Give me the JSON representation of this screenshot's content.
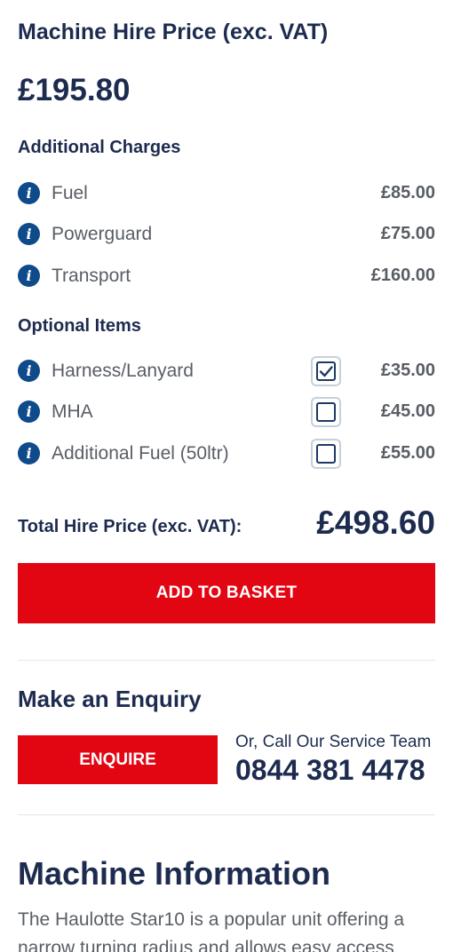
{
  "machine_hire": {
    "title": "Machine Hire Price (exc. VAT)",
    "price": "£195.80"
  },
  "additional_charges": {
    "heading": "Additional Charges",
    "items": [
      {
        "label": "Fuel",
        "price": "£85.00"
      },
      {
        "label": "Powerguard",
        "price": "£75.00"
      },
      {
        "label": "Transport",
        "price": "£160.00"
      }
    ]
  },
  "optional_items": {
    "heading": "Optional Items",
    "items": [
      {
        "label": "Harness/Lanyard",
        "price": "£35.00",
        "checked": true
      },
      {
        "label": "MHA",
        "price": "£45.00",
        "checked": false
      },
      {
        "label": "Additional Fuel (50ltr)",
        "price": "£55.00",
        "checked": false
      }
    ]
  },
  "total": {
    "label": "Total Hire Price (exc. VAT):",
    "value": "£498.60"
  },
  "basket_button": "ADD TO BASKET",
  "enquiry": {
    "title": "Make an Enquiry",
    "button": "ENQUIRE",
    "call_label": "Or, Call Our Service Team",
    "phone": "0844 381 4478"
  },
  "machine_info": {
    "title": "Machine Information",
    "description": "The Haulotte Star10 is a popular unit offering a narrow turning radius and allows easy access"
  },
  "icons": {
    "info": "info-icon",
    "check": "checkmark-icon"
  },
  "colors": {
    "primary_text": "#1d2b4f",
    "secondary_text": "#595e66",
    "accent_red": "#e20613",
    "info_blue": "#0f4a8a"
  }
}
